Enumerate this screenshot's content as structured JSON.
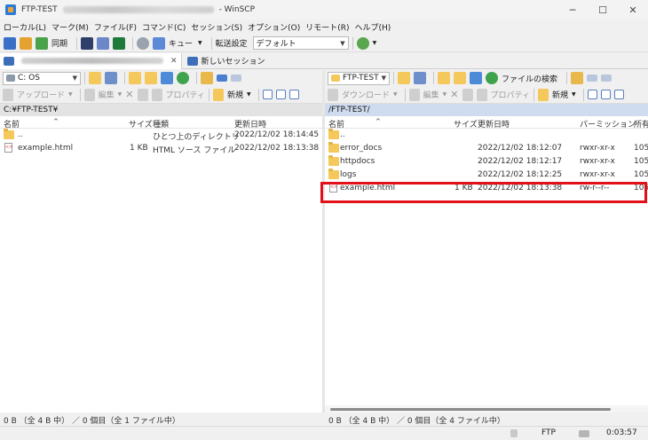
{
  "window": {
    "title": "FTP-TEST",
    "app_name": "WinSCP",
    "minimize": "─",
    "maximize": "☐",
    "close": "✕"
  },
  "menu": [
    "ローカル(L)",
    "マーク(M)",
    "ファイル(F)",
    "コマンド(C)",
    "セッション(S)",
    "オプション(O)",
    "リモート(R)",
    "ヘルプ(H)"
  ],
  "toolbar": {
    "sync_label": "同期",
    "queue_label": "キュー",
    "transfer_label": "転送設定",
    "transfer_value": "デフォルト"
  },
  "tabs": {
    "session_close": "✕",
    "new_session": "新しいセッション"
  },
  "left": {
    "drive": "C: OS",
    "upload": "アップロード",
    "edit": "編集",
    "properties": "プロパティ",
    "new": "新規",
    "path": "C:¥FTP-TEST¥",
    "headers": {
      "name": "名前",
      "size": "サイズ",
      "type": "種類",
      "modified": "更新日時"
    },
    "rows": [
      {
        "name": "..",
        "size": "",
        "type": "ひとつ上のディレクトリ",
        "modified": "2022/12/02  18:14:45",
        "kind": "folder"
      },
      {
        "name": "example.html",
        "size": "1 KB",
        "type": "HTML ソース ファイル",
        "modified": "2022/12/02  18:13:38",
        "kind": "file"
      }
    ],
    "status": "0 B （全 4 B 中） ／ 0 個目（全 1 ファイル中）"
  },
  "right": {
    "drive": "FTP-TEST",
    "find_files": "ファイルの検索",
    "download": "ダウンロード",
    "edit": "編集",
    "properties": "プロパティ",
    "new": "新規",
    "path": "/FTP-TEST/",
    "headers": {
      "name": "名前",
      "size": "サイズ",
      "modified": "更新日時",
      "permissions": "パーミッション",
      "owner": "所有"
    },
    "rows": [
      {
        "name": "..",
        "size": "",
        "modified": "",
        "permissions": "",
        "owner": "",
        "kind": "folder"
      },
      {
        "name": "error_docs",
        "size": "",
        "modified": "2022/12/02  18:12:07",
        "permissions": "rwxr-xr-x",
        "owner": "105",
        "kind": "folder"
      },
      {
        "name": "httpdocs",
        "size": "",
        "modified": "2022/12/02  18:12:17",
        "permissions": "rwxr-xr-x",
        "owner": "105",
        "kind": "folder"
      },
      {
        "name": "logs",
        "size": "",
        "modified": "2022/12/02  18:12:25",
        "permissions": "rwxr-xr-x",
        "owner": "105",
        "kind": "folder"
      },
      {
        "name": "example.html",
        "size": "1 KB",
        "modified": "2022/12/02  18:13:38",
        "permissions": "rw-r--r--",
        "owner": "105",
        "kind": "file"
      }
    ],
    "status": "0 B （全 4 B 中） ／ 0 個目（全 4 ファイル中）"
  },
  "bottom": {
    "protocol": "FTP",
    "elapsed": "0:03:57"
  },
  "colors": {
    "highlight": "#e3101a",
    "path_active": "#cfdcef",
    "folder": "#f4c85b"
  }
}
